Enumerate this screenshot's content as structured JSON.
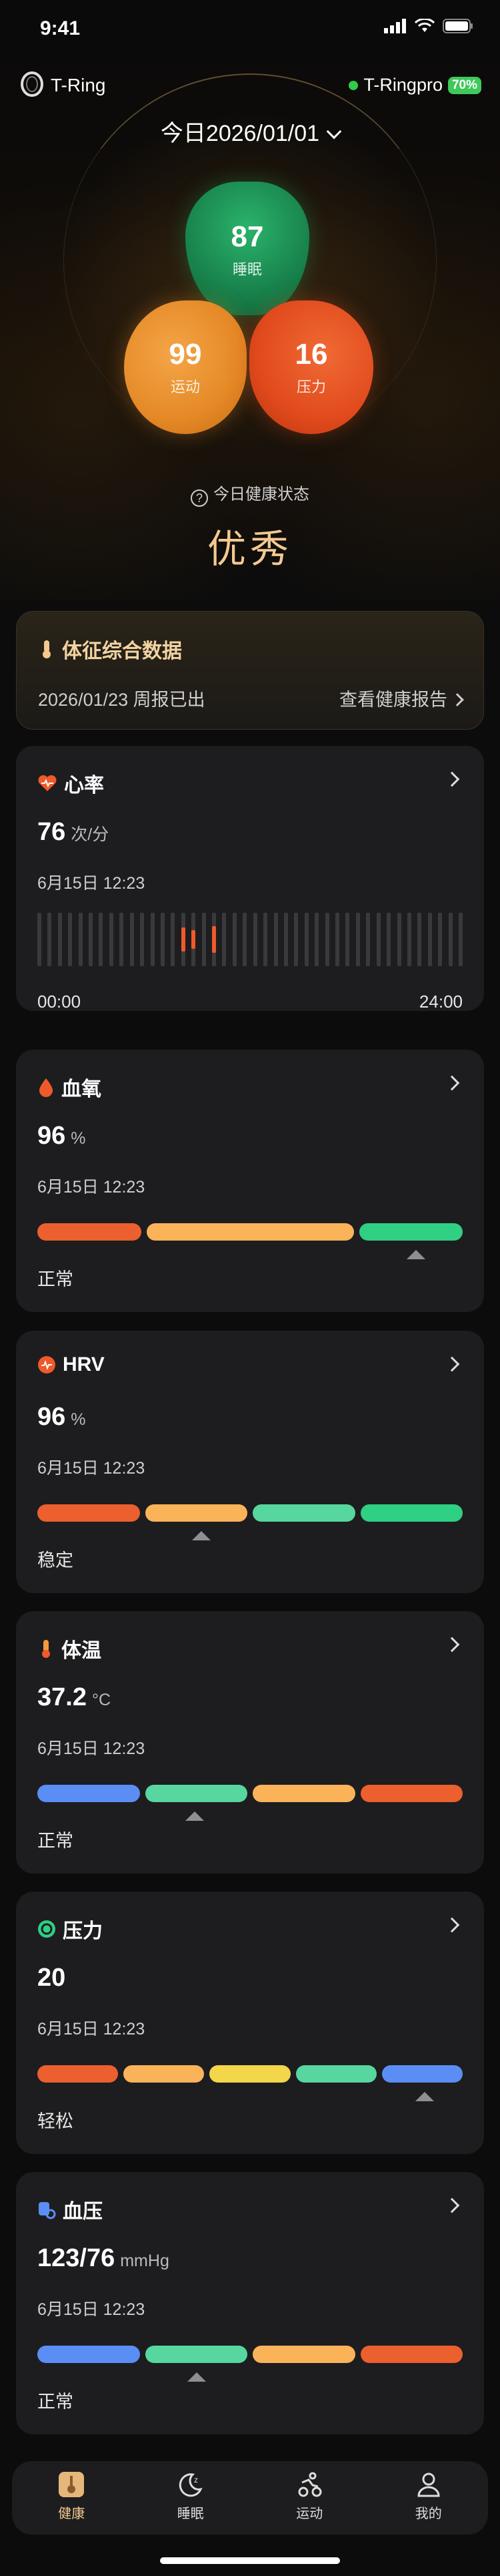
{
  "status_bar": {
    "time": "9:41"
  },
  "header": {
    "brand": "T-Ring",
    "device_name": "T-Ringpro",
    "battery": "70%",
    "date": "今日2026/01/01"
  },
  "scores": {
    "sleep": {
      "value": "87",
      "label": "睡眠"
    },
    "sport": {
      "value": "99",
      "label": "运动"
    },
    "stress": {
      "value": "16",
      "label": "压力"
    }
  },
  "health": {
    "question": "今日健康状态",
    "value": "优秀"
  },
  "report": {
    "title": "体征综合数据",
    "date_text": "2026/01/23 周报已出",
    "link": "查看健康报告"
  },
  "cards": {
    "heart": {
      "title": "心率",
      "value": "76",
      "unit": "次/分",
      "time": "6月15日 12:23",
      "axis_start": "00:00",
      "axis_end": "24:00",
      "samples": [
        {
          "slot": 14,
          "level": 0.45
        },
        {
          "slot": 15,
          "level": 0.35
        },
        {
          "slot": 17,
          "level": 0.5
        }
      ],
      "slots_total": 42
    },
    "spo2": {
      "title": "血氧",
      "value": "96",
      "unit": "%",
      "time": "6月15日 12:23",
      "status": "正常",
      "segments": [
        "#ec5f2e",
        "#fbb35a",
        "#2fcf84"
      ],
      "weights": [
        1,
        2,
        1
      ],
      "marker": 0.89
    },
    "hrv": {
      "title": "HRV",
      "value": "96",
      "unit": "%",
      "time": "6月15日 12:23",
      "status": "稳定",
      "segments": [
        "#ec5f2e",
        "#fbb35a",
        "#57d6a0",
        "#2fcf84"
      ],
      "weights": [
        1,
        1,
        1,
        1
      ],
      "marker": 0.385
    },
    "temp": {
      "title": "体温",
      "value": "37.2",
      "unit": "°C",
      "time": "6月15日 12:23",
      "status": "正常",
      "segments": [
        "#5b8ef5",
        "#57d6a0",
        "#fbb35a",
        "#ec5f2e"
      ],
      "weights": [
        1,
        1,
        1,
        1
      ],
      "marker": 0.37
    },
    "stress": {
      "title": "压力",
      "value": "20",
      "unit": "",
      "time": "6月15日 12:23",
      "status": "轻松",
      "segments": [
        "#ec5f2e",
        "#fbb35a",
        "#f4d64a",
        "#57d6a0",
        "#5b8ef5"
      ],
      "weights": [
        1,
        1,
        1,
        1,
        1
      ],
      "marker": 0.91
    },
    "bp": {
      "title": "血压",
      "value": "123/76",
      "unit": "mmHg",
      "time": "6月15日 12:23",
      "status": "正常",
      "segments": [
        "#5b8ef5",
        "#57d6a0",
        "#fbb35a",
        "#ec5f2e"
      ],
      "weights": [
        1,
        1,
        1,
        1
      ],
      "marker": 0.375
    }
  },
  "tabs": [
    {
      "label": "健康",
      "icon": "health-icon",
      "active": true
    },
    {
      "label": "睡眠",
      "icon": "sleep-icon",
      "active": false
    },
    {
      "label": "运动",
      "icon": "sport-icon",
      "active": false
    },
    {
      "label": "我的",
      "icon": "profile-icon",
      "active": false
    }
  ],
  "colors": {
    "accent": "#f3c98f",
    "card": "#1d1d1f",
    "heart_mark": "#ef5a2a"
  }
}
